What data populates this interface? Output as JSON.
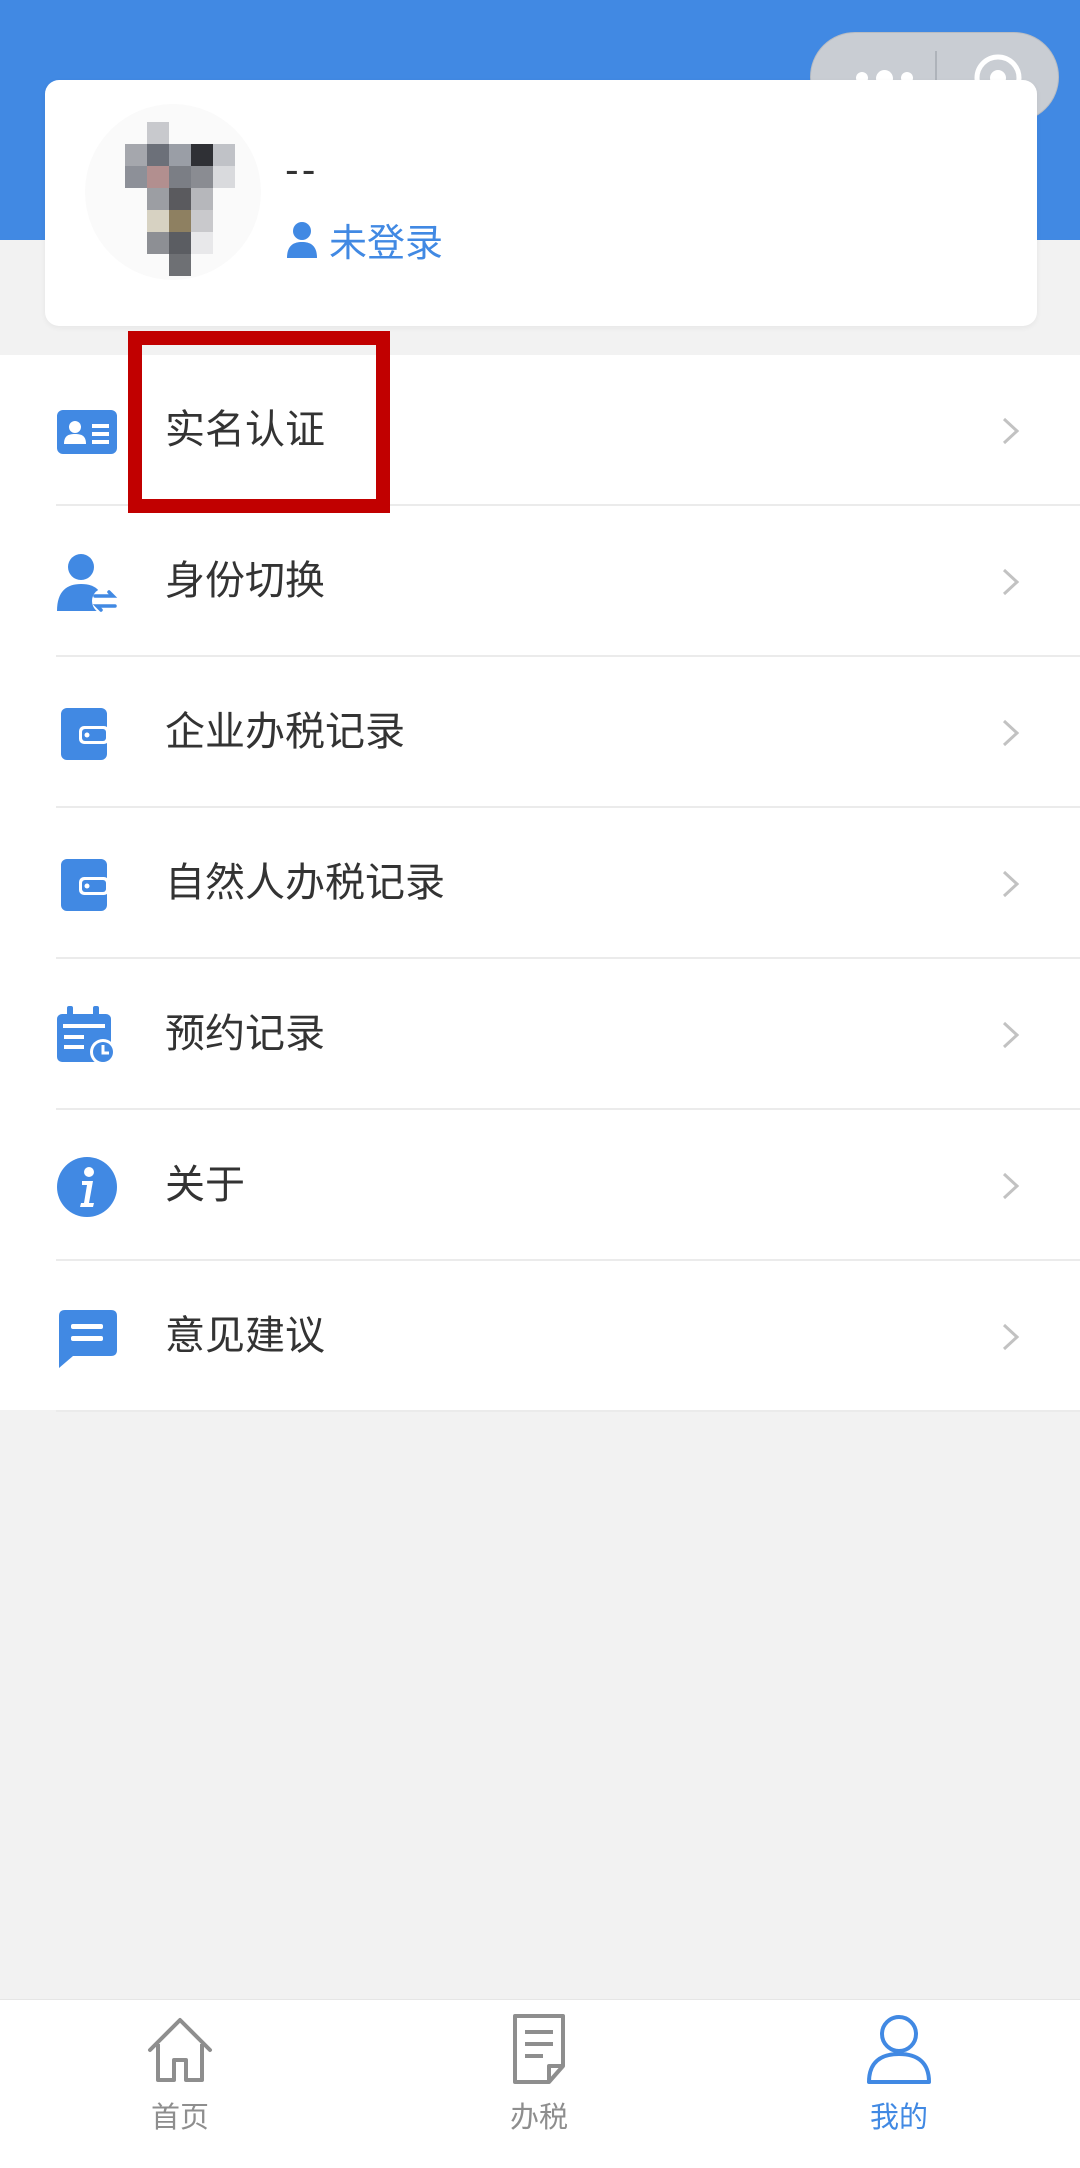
{
  "profile": {
    "username": "--",
    "login_status": "未登录"
  },
  "menu": [
    {
      "label": "实名认证",
      "icon": "id-card-icon"
    },
    {
      "label": "身份切换",
      "icon": "user-switch-icon"
    },
    {
      "label": "企业办税记录",
      "icon": "wallet-icon"
    },
    {
      "label": "自然人办税记录",
      "icon": "wallet-icon"
    },
    {
      "label": "预约记录",
      "icon": "calendar-clock-icon"
    },
    {
      "label": "关于",
      "icon": "info-icon"
    },
    {
      "label": "意见建议",
      "icon": "message-icon"
    }
  ],
  "tabs": [
    {
      "label": "首页",
      "icon": "home-icon"
    },
    {
      "label": "办税",
      "icon": "document-icon"
    },
    {
      "label": "我的",
      "icon": "user-icon",
      "active": true
    }
  ],
  "colors": {
    "brand": "#4189e3",
    "highlight": "#c10000",
    "background": "#f2f2f2"
  }
}
